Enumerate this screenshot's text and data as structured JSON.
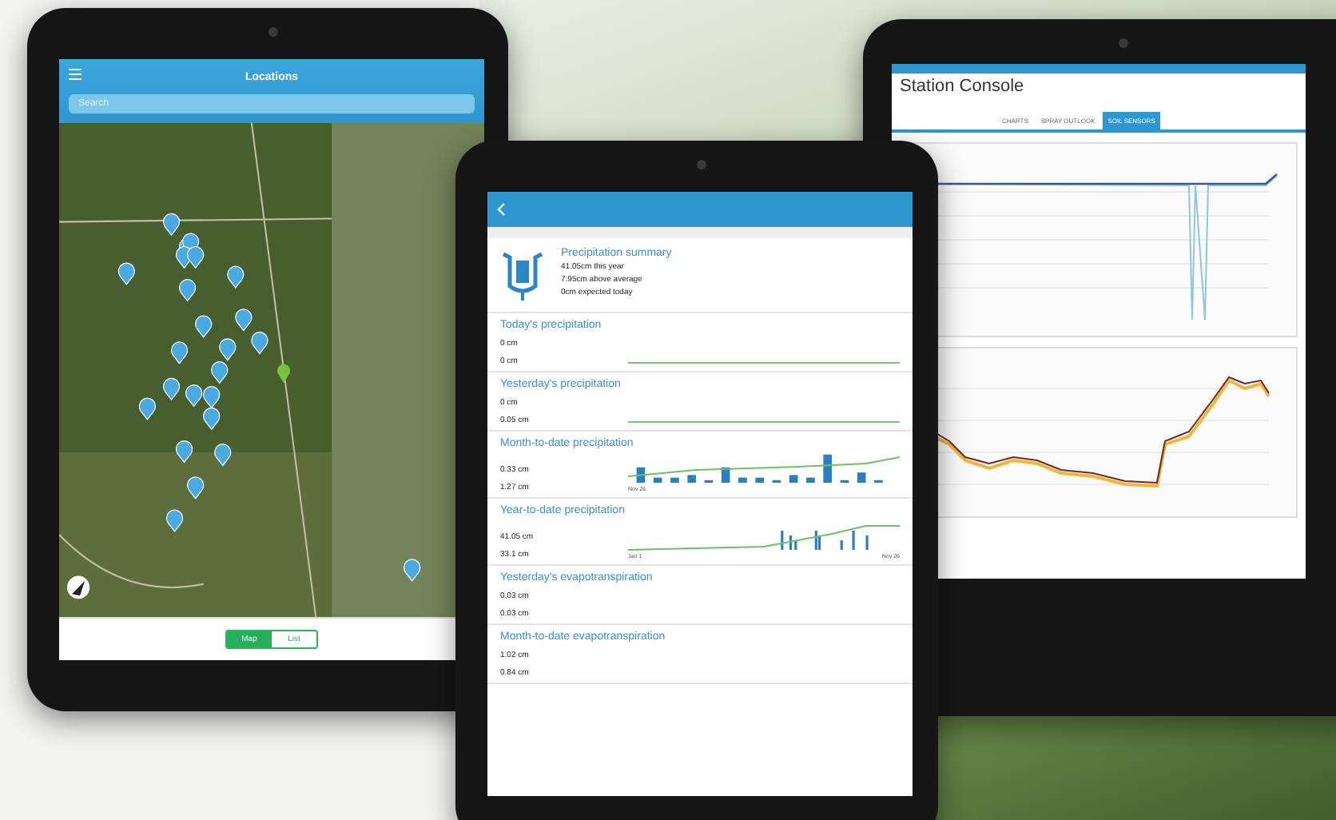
{
  "locations_tablet": {
    "title": "Locations",
    "search": {
      "placeholder": "Search"
    },
    "view_toggle": [
      {
        "label": "Map",
        "selected": true
      },
      {
        "label": "List",
        "selected": false
      }
    ]
  },
  "precipitation_tablet": {
    "summary": {
      "title": "Precipitation summary",
      "lines": [
        "41.05cm this year",
        "7.95cm above average",
        "0cm expected today"
      ]
    },
    "sections": [
      {
        "title": "Today's precipitation",
        "values": [
          "0 cm",
          "0 cm"
        ],
        "kind": "flat"
      },
      {
        "title": "Yesterday's precipitation",
        "values": [
          "0 cm",
          "0.05 cm"
        ],
        "kind": "flat"
      },
      {
        "title": "Month-to-date precipitation",
        "values": [
          "0.33 cm",
          "1.27 cm"
        ],
        "kind": "bars",
        "axis": [
          "Nov 26"
        ]
      },
      {
        "title": "Year-to-date precipitation",
        "values": [
          "41.05 cm",
          "33.1 cm"
        ],
        "kind": "spikes",
        "axis": [
          "Jan 1",
          "Nov 26"
        ]
      },
      {
        "title": "Yesterday's evapotranspiration",
        "values": [
          "0.03 cm",
          "0.03 cm"
        ],
        "kind": "plain"
      },
      {
        "title": "Month-to-date evapotranspiration",
        "values": [
          "1.02 cm",
          "0.84 cm"
        ],
        "kind": "plain"
      }
    ]
  },
  "station_tablet": {
    "title": "Station Console",
    "tabs": [
      {
        "label": "CHARTS",
        "selected": false
      },
      {
        "label": "SPRAY OUTLOOK",
        "selected": false
      },
      {
        "label": "SOIL SENSORS",
        "selected": true
      }
    ]
  }
}
